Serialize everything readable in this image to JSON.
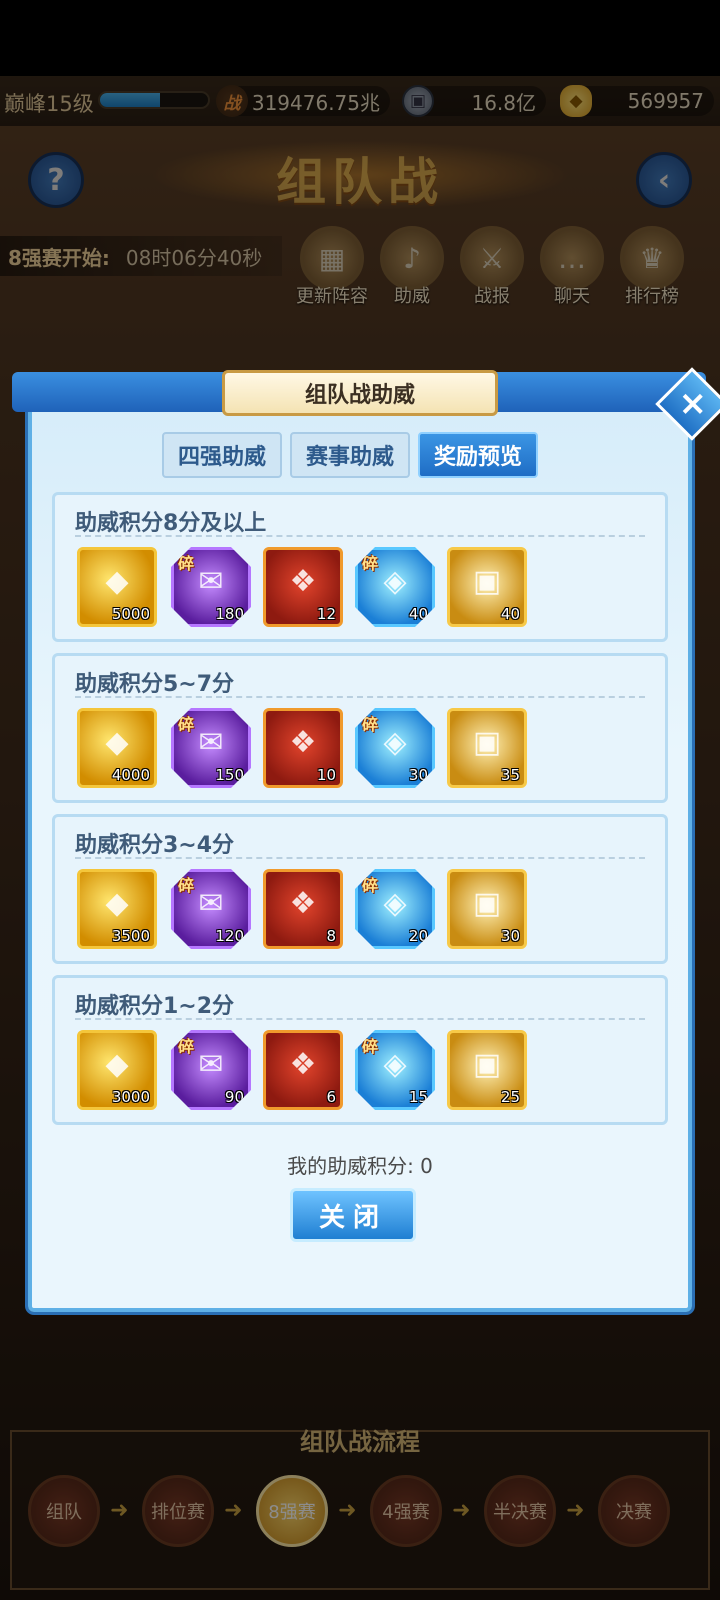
{
  "statusbar": {
    "rank": "巅峰15级",
    "exp_fraction": 0.56,
    "power_icon": "战",
    "power": "319476.75兆",
    "coins": "16.8亿",
    "gold": "569957"
  },
  "background": {
    "title": "组队战",
    "timer_label": "8强赛开始:",
    "timer_value": "08时06分40秒",
    "menu": [
      "更新阵容",
      "助威",
      "战报",
      "聊天",
      "排行榜"
    ],
    "flow_title": "组队战流程",
    "flow_steps": [
      "组队",
      "排位赛",
      "8强赛",
      "4强赛",
      "半决赛",
      "决赛"
    ]
  },
  "dialog": {
    "title": "组队战助威",
    "tabs": [
      "四强助威",
      "赛事助威",
      "奖励预览"
    ],
    "active_tab": "奖励预览",
    "frag_label": "碎",
    "tiers": [
      {
        "title": "助威积分8分及以上",
        "counts": [
          "5000",
          "180",
          "12",
          "40",
          "40"
        ]
      },
      {
        "title": "助威积分5~7分",
        "counts": [
          "4000",
          "150",
          "10",
          "30",
          "35"
        ]
      },
      {
        "title": "助威积分3~4分",
        "counts": [
          "3500",
          "120",
          "8",
          "20",
          "30"
        ]
      },
      {
        "title": "助威积分1~2分",
        "counts": [
          "3000",
          "90",
          "6",
          "15",
          "25"
        ]
      }
    ],
    "my_score": "我的助威积分: 0",
    "close_label": "关闭"
  }
}
